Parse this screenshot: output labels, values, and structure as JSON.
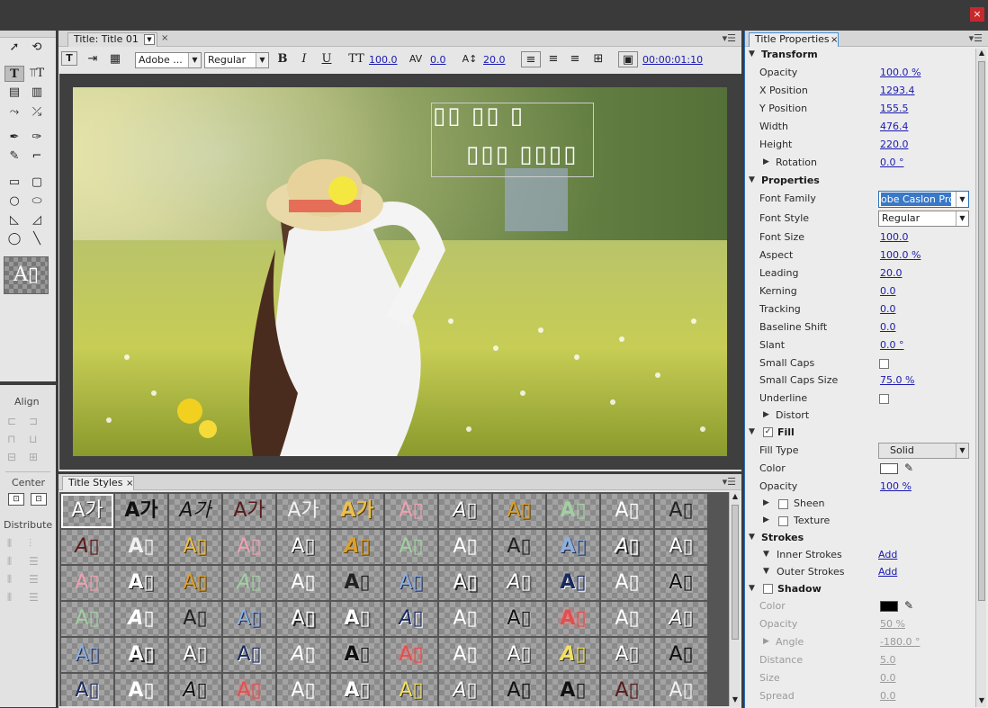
{
  "title_panel": {
    "tab_label": "Title: Title 01",
    "font_family": "Adobe ...",
    "font_style": "Regular",
    "font_size": "100.0",
    "kerning": "0.0",
    "leading": "20.0",
    "timecode": "00:00:01:10",
    "overlay_line1": "▯▯ ▯▯ ▯",
    "overlay_line2": "▯▯▯ ▯▯▯▯"
  },
  "tools": {
    "align_label": "Align",
    "center_label": "Center",
    "distribute_label": "Distribute",
    "preview_text": "A▯"
  },
  "title_styles": {
    "tab_label": "Title Styles",
    "swatches": [
      "A가",
      "A가",
      "A가",
      "A가",
      "A가",
      "A가",
      "A▯",
      "A▯",
      "A▯",
      "A▯",
      "A▯",
      "A▯",
      "A▯",
      "A▯",
      "A▯",
      "A▯",
      "A▯",
      "A▯",
      "A▯",
      "A▯",
      "A▯",
      "A▯",
      "A▯",
      "A▯",
      "A▯",
      "A▯",
      "A▯",
      "A▯",
      "A▯",
      "A▯",
      "A▯",
      "A▯",
      "A▯",
      "A▯",
      "A▯",
      "A▯",
      "A▯",
      "A▯",
      "A▯",
      "A▯",
      "A▯",
      "A▯",
      "A▯",
      "A▯",
      "A▯",
      "A▯",
      "A▯",
      "A▯",
      "A▯",
      "A▯",
      "A▯",
      "A▯",
      "A▯",
      "A▯",
      "A▯",
      "A▯",
      "A▯",
      "A▯",
      "A▯",
      "A▯",
      "A▯",
      "A▯",
      "A▯",
      "A▯",
      "A▯",
      "A▯",
      "A▯",
      "A▯",
      "A▯",
      "A▯",
      "A▯",
      "A▯"
    ]
  },
  "properties": {
    "tab_label": "Title Properties",
    "transform": {
      "header": "Transform",
      "opacity": {
        "label": "Opacity",
        "value": "100.0 %"
      },
      "x": {
        "label": "X Position",
        "value": "1293.4"
      },
      "y": {
        "label": "Y Position",
        "value": "155.5"
      },
      "width": {
        "label": "Width",
        "value": "476.4"
      },
      "height": {
        "label": "Height",
        "value": "220.0"
      },
      "rotation": {
        "label": "Rotation",
        "value": "0.0 °"
      }
    },
    "props": {
      "header": "Properties",
      "font_family": {
        "label": "Font Family",
        "value": "obe Caslon Pro"
      },
      "font_style": {
        "label": "Font Style",
        "value": "Regular"
      },
      "font_size": {
        "label": "Font Size",
        "value": "100.0"
      },
      "aspect": {
        "label": "Aspect",
        "value": "100.0 %"
      },
      "leading": {
        "label": "Leading",
        "value": "20.0"
      },
      "kerning": {
        "label": "Kerning",
        "value": "0.0"
      },
      "tracking": {
        "label": "Tracking",
        "value": "0.0"
      },
      "baseline": {
        "label": "Baseline Shift",
        "value": "0.0"
      },
      "slant": {
        "label": "Slant",
        "value": "0.0 °"
      },
      "small_caps": {
        "label": "Small Caps"
      },
      "small_caps_size": {
        "label": "Small Caps Size",
        "value": "75.0 %"
      },
      "underline": {
        "label": "Underline"
      },
      "distort": {
        "label": "Distort"
      }
    },
    "fill": {
      "header": "Fill",
      "fill_type": {
        "label": "Fill Type",
        "value": "Solid"
      },
      "color": {
        "label": "Color"
      },
      "opacity": {
        "label": "Opacity",
        "value": "100 %"
      },
      "sheen": {
        "label": "Sheen"
      },
      "texture": {
        "label": "Texture"
      }
    },
    "strokes": {
      "header": "Strokes",
      "inner": {
        "label": "Inner Strokes",
        "value": "Add"
      },
      "outer": {
        "label": "Outer Strokes",
        "value": "Add"
      }
    },
    "shadow": {
      "header": "Shadow",
      "color": {
        "label": "Color"
      },
      "opacity": {
        "label": "Opacity",
        "value": "50 %"
      },
      "angle": {
        "label": "Angle",
        "value": "-180.0 °"
      },
      "distance": {
        "label": "Distance",
        "value": "5.0"
      },
      "size": {
        "label": "Size",
        "value": "0.0"
      },
      "spread": {
        "label": "Spread",
        "value": "0.0"
      }
    }
  },
  "colors": {
    "accent": "#1a1ab0",
    "close": "#c8282c"
  }
}
